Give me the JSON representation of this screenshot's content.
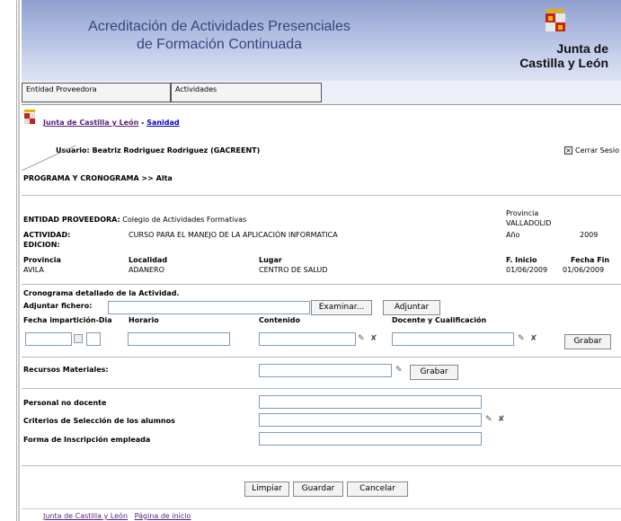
{
  "header": {
    "title_line1": "Acreditación de Actividades Presenciales",
    "title_line2": "de Formación Continuada",
    "brand_line1": "Junta de",
    "brand_line2": "Castilla y León"
  },
  "tabs": [
    "Entidad Proveedora",
    "Actividades"
  ],
  "breadcrumb": {
    "home": "Junta de Castilla y León",
    "sep": " - ",
    "section": "Sanidad"
  },
  "user": {
    "text": "Usuario: Beatriz Rodriguez Rodriguez (GACREENT)"
  },
  "logout": {
    "label": "Cerrar Sesio"
  },
  "page_title": "PROGRAMA Y CRONOGRAMA >> Alta",
  "entity": {
    "label": "ENTIDAD PROVEEDORA:",
    "value": "Colegio de Actividades Formativas",
    "provincia_label": "Provincia",
    "provincia_value": "VALLADOLID",
    "actividad_label": "ACTIVIDAD:",
    "actividad_value": "CURSO PARA EL MANEJO DE LA APLICACIÓN INFORMATICA",
    "anio_label": "Año",
    "anio_value": "2009",
    "edicion_label": "EDICION:"
  },
  "location": {
    "provincia_label": "Provincia",
    "provincia_value": "AVILA",
    "localidad_label": "Localidad",
    "localidad_value": "ADANERO",
    "lugar_label": "Lugar",
    "lugar_value": "CENTRO DE SALUD",
    "finicio_label": "F. Inicio",
    "finicio_value": "01/06/2009",
    "ffin_label": "Fecha Fin",
    "ffin_value": "01/06/2009"
  },
  "schedule": {
    "heading": "Cronograma detallado de la Actividad.",
    "attach_label": "Adjuntar fichero:",
    "browse_button": "Examinar...",
    "attach_button": "Adjuntar",
    "col_fecha": "Fecha impartición-Dia",
    "col_horario": "Horario",
    "col_contenido": "Contenido",
    "col_docente": "Docente y Cualificación",
    "save_button": "Grabar"
  },
  "resources": {
    "label": "Recursos Materiales:",
    "save_button": "Grabar"
  },
  "extra": {
    "personal_label": "Personal no docente",
    "criterios_label": "Criterios de Selección de los alumnos",
    "forma_label": "Forma de Inscripción empleada"
  },
  "actions": {
    "clear": "Limpiar",
    "save": "Guardar",
    "cancel": "Cancelar"
  },
  "footer": {
    "link1": "Junta de Castilla y León",
    "link2": "Página de inicio"
  }
}
